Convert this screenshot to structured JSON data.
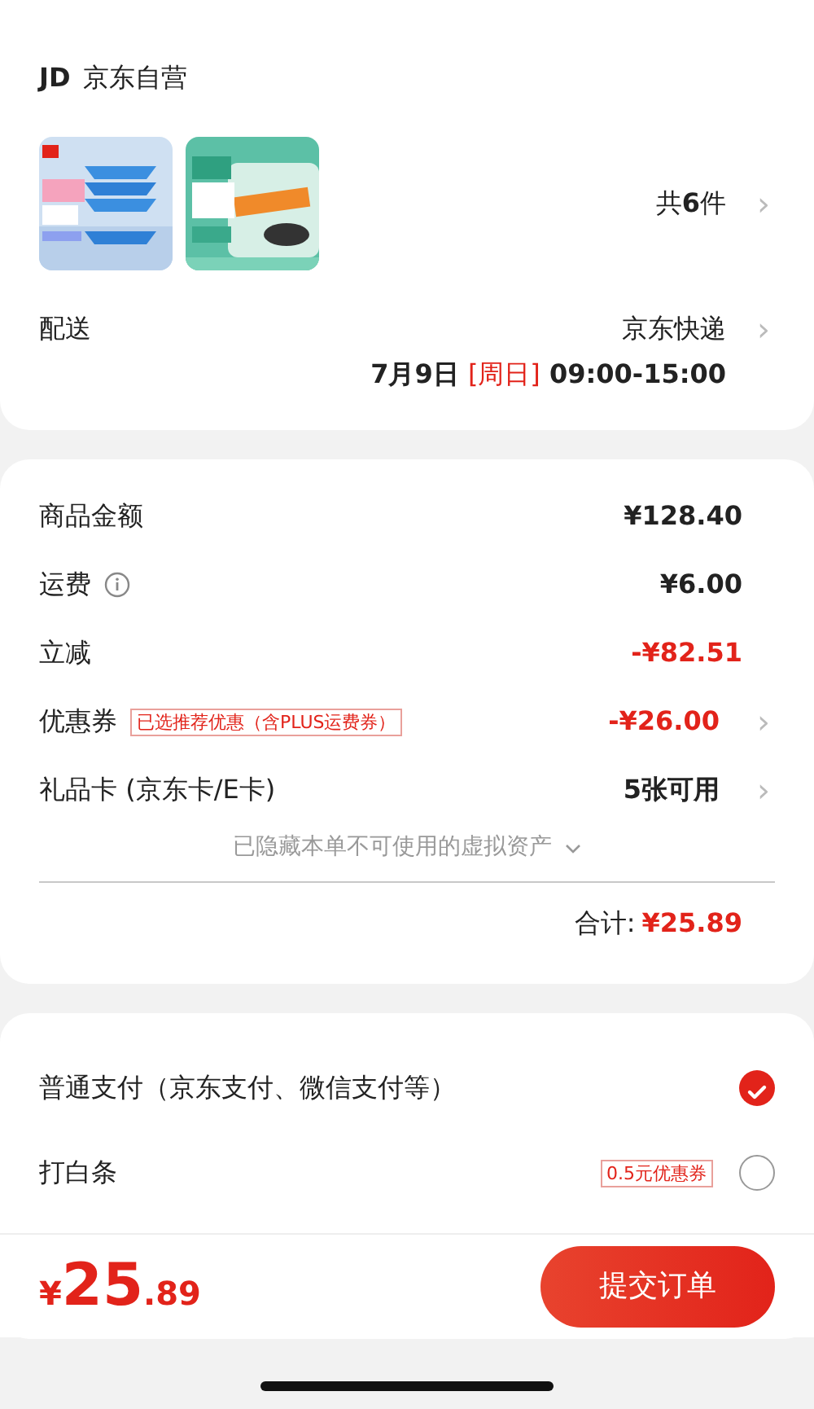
{
  "shop": {
    "logo": "JD",
    "name": "京东自营"
  },
  "item_count": {
    "prefix": "共",
    "count": "6",
    "suffix": "件",
    "chevron": "›"
  },
  "delivery": {
    "label": "配送",
    "method": "京东快递",
    "chevron": "›",
    "date": "7月9日",
    "weekday": "[周日]",
    "time": "09:00-15:00"
  },
  "price_rows": [
    {
      "kind": "plain",
      "label": "商品金额",
      "value": "¥128.40",
      "highlight": false
    },
    {
      "kind": "info",
      "label": "运费",
      "value": "¥6.00",
      "highlight": false
    },
    {
      "kind": "plain",
      "label": "立减",
      "value": "-¥82.51",
      "highlight": true
    },
    {
      "kind": "tag",
      "label": "优惠券",
      "tag": "已选推荐优惠（含PLUS运费券）",
      "value": "-¥26.00",
      "highlight": true,
      "chevron": "›"
    },
    {
      "kind": "plain",
      "label": "礼品卡 (京东卡/E卡)",
      "value": "5张可用",
      "highlight": false,
      "chevron": "›"
    }
  ],
  "hidden_note": "已隐藏本单不可使用的虚拟资产",
  "total": {
    "label": "合计:",
    "value": "¥25.89"
  },
  "payment_methods": [
    {
      "label": "普通支付（京东支付、微信支付等）",
      "selected": true
    },
    {
      "label": "打白条",
      "tag": "0.5元优惠券",
      "selected": false
    }
  ],
  "footer": {
    "currency": "¥",
    "integer": "25",
    "decimal": ".89",
    "submit": "提交订单"
  }
}
